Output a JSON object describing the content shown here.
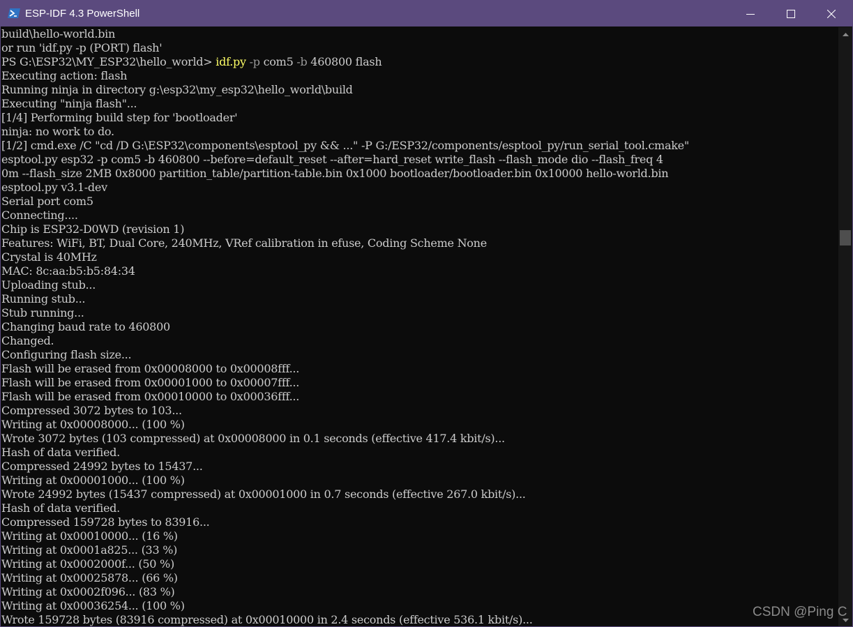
{
  "window": {
    "title": "ESP-IDF 4.3 PowerShell",
    "controls": {
      "minimize_icon": "minimize-icon",
      "maximize_icon": "maximize-icon",
      "close_icon": "close-icon"
    },
    "colors": {
      "titlebar": "#5b4a7e",
      "console_bg": "#0c0c0c",
      "text": "#cccccc",
      "command": "#ffff66",
      "parameter": "#9a9a9a"
    }
  },
  "console": {
    "lines": [
      "build\\hello-world.bin",
      "or run 'idf.py -p (PORT) flash'",
      {
        "prompt": "PS G:\\ESP32\\MY_ESP32\\hello_world> ",
        "cmd": "idf.py",
        "sp1": " ",
        "p1": "-p",
        "v1": " com5 ",
        "p2": "-b",
        "v2": " 460800 flash"
      },
      "Executing action: flash",
      "Running ninja in directory g:\\esp32\\my_esp32\\hello_world\\build",
      "Executing \"ninja flash\"...",
      "[1/4] Performing build step for 'bootloader'",
      "ninja: no work to do.",
      "[1/2] cmd.exe /C \"cd /D G:\\ESP32\\components\\esptool_py && ...\" -P G:/ESP32/components/esptool_py/run_serial_tool.cmake\"",
      "esptool.py esp32 -p com5 -b 460800 --before=default_reset --after=hard_reset write_flash --flash_mode dio --flash_freq 4",
      "0m --flash_size 2MB 0x8000 partition_table/partition-table.bin 0x1000 bootloader/bootloader.bin 0x10000 hello-world.bin",
      "esptool.py v3.1-dev",
      "Serial port com5",
      "Connecting....",
      "Chip is ESP32-D0WD (revision 1)",
      "Features: WiFi, BT, Dual Core, 240MHz, VRef calibration in efuse, Coding Scheme None",
      "Crystal is 40MHz",
      "MAC: 8c:aa:b5:b5:84:34",
      "Uploading stub...",
      "Running stub...",
      "Stub running...",
      "Changing baud rate to 460800",
      "Changed.",
      "Configuring flash size...",
      "Flash will be erased from 0x00008000 to 0x00008fff...",
      "Flash will be erased from 0x00001000 to 0x00007fff...",
      "Flash will be erased from 0x00010000 to 0x00036fff...",
      "Compressed 3072 bytes to 103...",
      "Writing at 0x00008000... (100 %)",
      "Wrote 3072 bytes (103 compressed) at 0x00008000 in 0.1 seconds (effective 417.4 kbit/s)...",
      "Hash of data verified.",
      "Compressed 24992 bytes to 15437...",
      "Writing at 0x00001000... (100 %)",
      "Wrote 24992 bytes (15437 compressed) at 0x00001000 in 0.7 seconds (effective 267.0 kbit/s)...",
      "Hash of data verified.",
      "Compressed 159728 bytes to 83916...",
      "Writing at 0x00010000... (16 %)",
      "Writing at 0x0001a825... (33 %)",
      "Writing at 0x0002000f... (50 %)",
      "Writing at 0x00025878... (66 %)",
      "Writing at 0x0002f096... (83 %)",
      "Writing at 0x00036254... (100 %)",
      "Wrote 159728 bytes (83916 compressed) at 0x00010000 in 2.4 seconds (effective 536.1 kbit/s)..."
    ]
  },
  "scrollbar": {
    "thumb_position": 0.34
  },
  "watermark": "CSDN @Ping C"
}
